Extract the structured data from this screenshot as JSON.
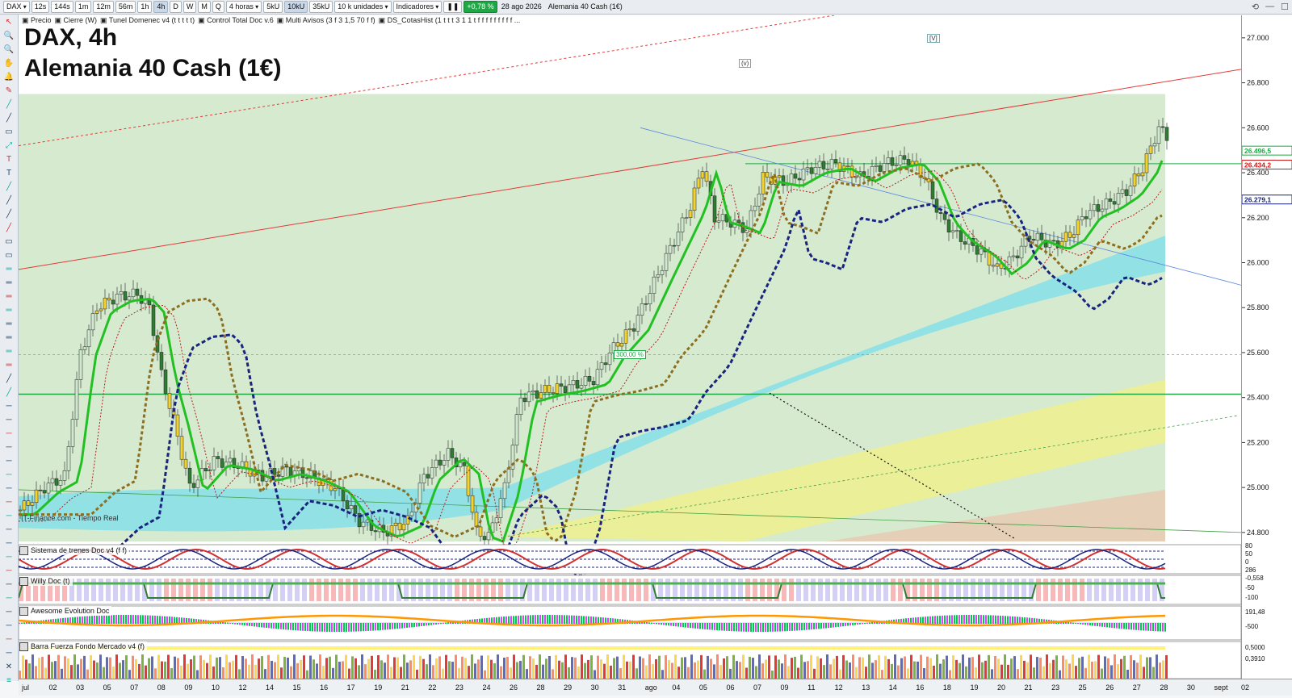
{
  "toolbar": {
    "symbol": "DAX",
    "timeframes": [
      "12s",
      "144s",
      "1m",
      "12m",
      "56m",
      "1h",
      "4h",
      "D",
      "W",
      "M",
      "Q"
    ],
    "period_select": "4 horas",
    "units_buttons": [
      "5kU",
      "10kU",
      "35kU"
    ],
    "units_select": "10 k unidades",
    "indicators_label": "Indicadores",
    "change_badge": "+0,78 %",
    "date_label": "28 ago 2026",
    "instrument_label": "Alemania 40 Cash (1€)"
  },
  "legend_bar": {
    "items": [
      "Precio",
      "Cierre (W)",
      "Tunel Domenec v4 (t t t t t)",
      "Control Total Doc v.6",
      "Multi Avisos (3 f 3 1,5 70 f f)",
      "DS_CotasHist (1 t t t 3 1 1 t f f f f f f f f f ..."
    ]
  },
  "chart": {
    "title_line1": "DAX, 4h",
    "title_line2": "Alemania 40 Cash (1€)",
    "watermark": "IT-Finance.com - Tiempo Real",
    "annotation_pct": "300,00 %",
    "marker_v_small": "(v)",
    "marker_v_big": "[V]"
  },
  "price_axis": {
    "ticks": [
      "27.000",
      "26.800",
      "26.600",
      "26.400",
      "26.200",
      "26.000",
      "25.800",
      "25.600",
      "25.400",
      "25.200",
      "25.000",
      "24.800"
    ],
    "labels": [
      {
        "text": "26.496,5",
        "color": "#1ea845"
      },
      {
        "text": "26.434,2",
        "color": "#d01818"
      },
      {
        "text": "26.279,1",
        "color": "#1a237e"
      }
    ]
  },
  "panels": [
    {
      "name": "Sistema de trenes Doc v4 (f f)",
      "scale": [
        "80",
        "50",
        "0",
        "286"
      ]
    },
    {
      "name": "Willy Doc (t)",
      "scale": [
        "-0,558",
        "-50",
        "-100"
      ]
    },
    {
      "name": "Awesome Evolution Doc",
      "scale": [
        "191,48",
        "-500"
      ]
    },
    {
      "name": "Barra Fuerza Fondo Mercado v4 (f)",
      "scale": [
        "0,5000",
        "0,3910"
      ]
    }
  ],
  "date_axis": {
    "labels": [
      "jul",
      "02",
      "03",
      "05",
      "07",
      "08",
      "09",
      "10",
      "12",
      "14",
      "15",
      "16",
      "17",
      "19",
      "21",
      "22",
      "23",
      "24",
      "26",
      "28",
      "29",
      "30",
      "31",
      "ago",
      "04",
      "05",
      "06",
      "07",
      "09",
      "11",
      "12",
      "13",
      "14",
      "16",
      "18",
      "19",
      "20",
      "21",
      "23",
      "25",
      "26",
      "27",
      "28",
      "30",
      "sept",
      "02"
    ]
  },
  "colors": {
    "bull_candle": "#2e7d32",
    "bear_candle": "#c62828",
    "fast_ma": "#22c022",
    "slow_ma_dotted": "#1a237e",
    "mid_ma_dotted": "#8d6e1f",
    "trend_red": "#e53935",
    "support_green": "#1ea845",
    "band_cyan": "#80deea",
    "band_yellow": "#f0f08a",
    "band_green_bg": "#d6ead0"
  }
}
